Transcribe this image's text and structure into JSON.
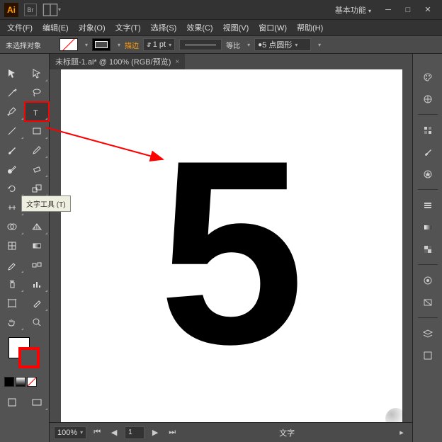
{
  "titlebar": {
    "app": "Ai",
    "bridge": "Br",
    "workspace_label": "基本功能"
  },
  "menu": {
    "file": "文件(F)",
    "edit": "编辑(E)",
    "object": "对象(O)",
    "type": "文字(T)",
    "select": "选择(S)",
    "effect": "效果(C)",
    "view": "视图(V)",
    "window": "窗口(W)",
    "help": "帮助(H)"
  },
  "ctrlbar": {
    "noselect": "未选择对象",
    "stroke_label": "描边",
    "stroke_weight": "1 pt",
    "scale": "等比",
    "brush": "5 点圆形"
  },
  "doc": {
    "tab": "未标题-1.ai* @ 100% (RGB/预览)",
    "content": "5"
  },
  "status": {
    "zoom": "100%",
    "page": "1",
    "mode": "文字"
  },
  "tooltip": {
    "type_tool": "文字工具 (T)"
  }
}
